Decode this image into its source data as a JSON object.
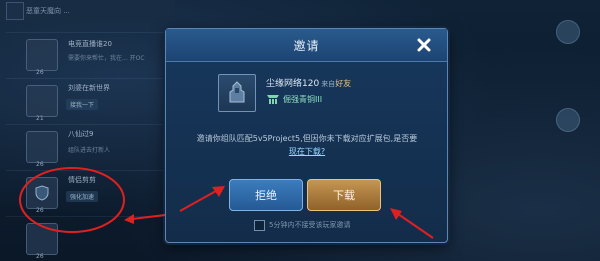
{
  "background": {
    "top_bar_text": "恶童天魔向 ...",
    "rows": [
      {
        "name": "电竞直播谁20",
        "message": "需要你来帮忙，我在... 开OC",
        "level": "26"
      },
      {
        "name": "刘婆在新世界",
        "tag": "接我一下",
        "level": "21"
      },
      {
        "name": "八仙过9",
        "message": "组队进去打新人",
        "level": "26"
      },
      {
        "name": "情侣剪剪",
        "tag": "强化加速",
        "level": "26"
      },
      {
        "name": "",
        "message": "",
        "level": "26"
      }
    ]
  },
  "dialog": {
    "title": "邀请",
    "close_icon": "close-icon",
    "inviter": {
      "name": "尘缘网络120",
      "from_label": "来自",
      "relation": "好友",
      "rank": "倔强青铜III",
      "avatar_icon": "hero-avatar-icon",
      "rank_icon": "bronze-rank-icon"
    },
    "message": "邀请你组队匹配5v5Project5,但因你未下载对应扩展包,是否要",
    "download_link": "现在下载?",
    "reject_label": "拒绝",
    "download_label": "下载",
    "option_label": "5分钟内不接受该玩家邀请"
  },
  "colors": {
    "accent_blue": "#3c7cbd",
    "accent_gold": "#c59653",
    "annotation_red": "#e02020"
  }
}
